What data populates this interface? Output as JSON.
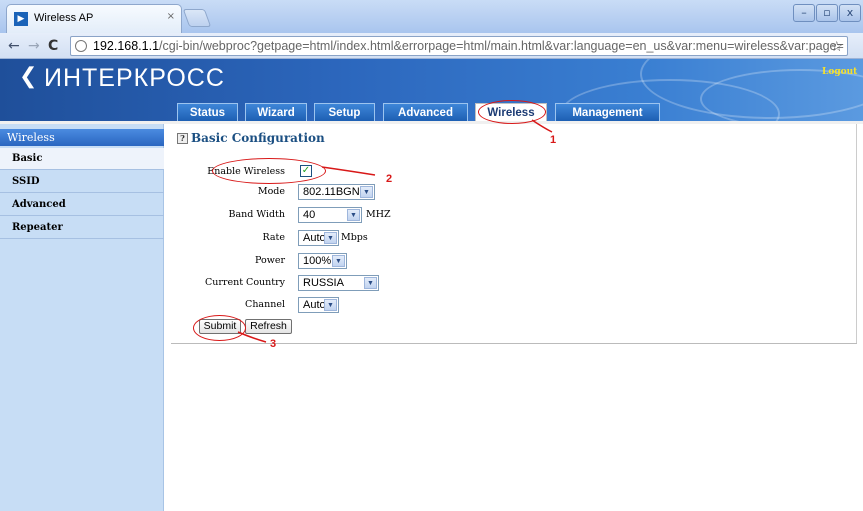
{
  "browser": {
    "tab_title": "Wireless AP",
    "tab_close": "×",
    "url_host": "192.168.1.1",
    "url_path": "/cgi-bin/webproc?getpage=html/index.html&errorpage=html/main.html&var:language=en_us&var:menu=wireless&var:page=",
    "window_min": "–",
    "window_max": "▫",
    "window_close": "x"
  },
  "router": {
    "brand": "ИНТЕРКРОСС",
    "logo_mark": "❮",
    "logout": "Logout",
    "tabs": [
      {
        "label": "Status"
      },
      {
        "label": "Wizard"
      },
      {
        "label": "Setup"
      },
      {
        "label": "Advanced"
      },
      {
        "label": "Wireless"
      },
      {
        "label": "Management"
      }
    ]
  },
  "sidebar": {
    "heading": "Wireless",
    "items": [
      {
        "label": "Basic"
      },
      {
        "label": "SSID"
      },
      {
        "label": "Advanced"
      },
      {
        "label": "Repeater"
      }
    ]
  },
  "form": {
    "help_glyph": "?",
    "title": "Basic Configuration",
    "enable_wireless_label": "Enable Wireless",
    "enable_wireless_checked": true,
    "mode_label": "Mode",
    "mode_value": "802.11BGN",
    "band_width_label": "Band Width",
    "band_width_value": "40",
    "band_width_unit": "MHZ",
    "rate_label": "Rate",
    "rate_value": "Auto",
    "rate_unit": "Mbps",
    "power_label": "Power",
    "power_value": "100%",
    "country_label": "Current Country",
    "country_value": "RUSSIA",
    "channel_label": "Channel",
    "channel_value": "Auto",
    "submit_label": "Submit",
    "refresh_label": "Refresh"
  },
  "annotations": [
    "1",
    "2",
    "3"
  ],
  "colors": {
    "header_blue": "#2c67bd",
    "sidebar_bg": "#c7ddf5",
    "annotation_red": "#d81818",
    "logout_yellow": "#f7e12a"
  }
}
